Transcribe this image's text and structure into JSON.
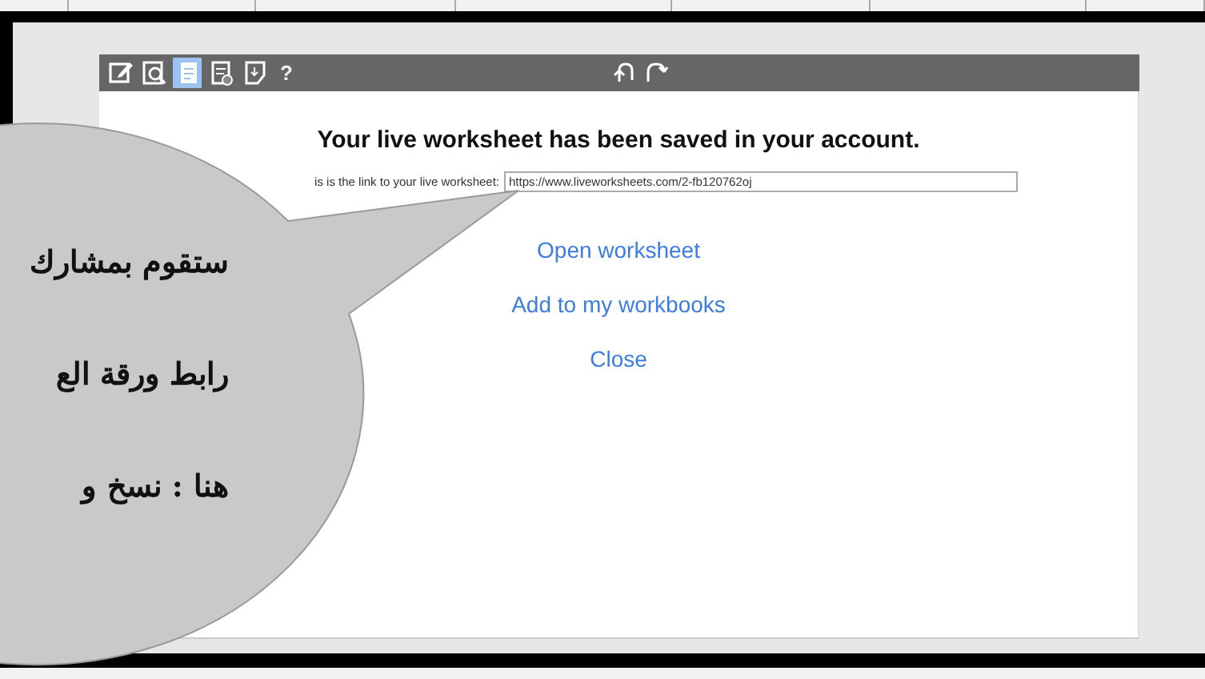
{
  "toolbar": {
    "tools": [
      {
        "selected": false
      },
      {
        "selected": false
      },
      {
        "selected": true
      },
      {
        "selected": false
      },
      {
        "selected": false
      }
    ],
    "help": "?"
  },
  "dialog": {
    "heading": "Your live worksheet has been saved in your account.",
    "link_label": "is is the link to your live worksheet:",
    "link_value": "https://www.liveworksheets.com/2-fb120762oj",
    "links": [
      "Open worksheet",
      "Add to my workbooks",
      "Close"
    ]
  },
  "callout": {
    "lines": [
      "ستقوم بمشارك",
      "رابط ورقة الع",
      "هنا : نسخ و"
    ]
  }
}
